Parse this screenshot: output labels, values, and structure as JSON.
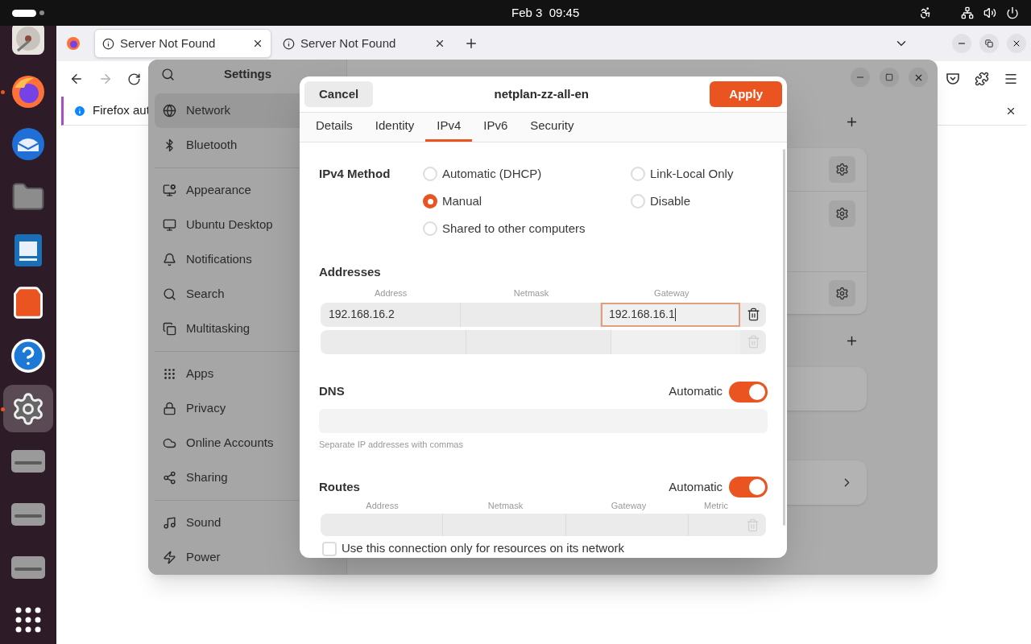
{
  "top_bar": {
    "clock": "Feb 3  09:45"
  },
  "dock": {
    "items": [
      {
        "kind": "disk",
        "selected": false,
        "running": false
      },
      {
        "kind": "browser",
        "selected": false,
        "running": true
      },
      {
        "kind": "mail",
        "selected": false,
        "running": false
      },
      {
        "kind": "files",
        "selected": false,
        "running": false
      },
      {
        "kind": "writer",
        "selected": false,
        "running": false
      },
      {
        "kind": "store",
        "selected": false,
        "running": false
      },
      {
        "kind": "help",
        "selected": false,
        "running": false
      },
      {
        "kind": "settings",
        "selected": true,
        "running": true
      },
      {
        "kind": "drive",
        "selected": false,
        "running": false
      },
      {
        "kind": "drive",
        "selected": false,
        "running": false
      },
      {
        "kind": "drive",
        "selected": false,
        "running": false
      },
      {
        "kind": "grid",
        "selected": false,
        "running": false
      }
    ]
  },
  "browser": {
    "tabs": [
      {
        "title": "Server Not Found",
        "selected": true
      },
      {
        "title": "Server Not Found",
        "selected": false
      }
    ],
    "forward_disabled": true,
    "notification": "Firefox aut"
  },
  "settings": {
    "title": "Settings",
    "sidebar": [
      [
        {
          "kind": "network",
          "label": "Network",
          "selected": true
        },
        {
          "kind": "bluetooth",
          "label": "Bluetooth",
          "selected": false
        }
      ],
      [
        {
          "kind": "appearance",
          "label": "Appearance",
          "selected": false
        },
        {
          "kind": "desktop",
          "label": "Ubuntu Desktop",
          "selected": false
        },
        {
          "kind": "bell",
          "label": "Notifications",
          "selected": false
        },
        {
          "kind": "search",
          "label": "Search",
          "selected": false
        },
        {
          "kind": "windows",
          "label": "Multitasking",
          "selected": false
        }
      ],
      [
        {
          "kind": "apps",
          "label": "Apps",
          "selected": false
        },
        {
          "kind": "lock",
          "label": "Privacy",
          "selected": false
        },
        {
          "kind": "cloud",
          "label": "Online Accounts",
          "selected": false
        },
        {
          "kind": "share",
          "label": "Sharing",
          "selected": false
        }
      ],
      [
        {
          "kind": "music",
          "label": "Sound",
          "selected": false
        },
        {
          "kind": "power",
          "label": "Power",
          "selected": false
        }
      ]
    ]
  },
  "dialog": {
    "title": "netplan-zz-all-en",
    "cancel": "Cancel",
    "apply": "Apply",
    "tabs": [
      {
        "label": "Details",
        "selected": false
      },
      {
        "label": "Identity",
        "selected": false
      },
      {
        "label": "IPv4",
        "selected": true
      },
      {
        "label": "IPv6",
        "selected": false
      },
      {
        "label": "Security",
        "selected": false
      }
    ],
    "method": {
      "label": "IPv4 Method",
      "options": [
        {
          "label": "Automatic (DHCP)",
          "selected": false
        },
        {
          "label": "Link-Local Only",
          "selected": false
        },
        {
          "label": "Manual",
          "selected": true
        },
        {
          "label": "Disable",
          "selected": false
        },
        {
          "label": "Shared to other computers",
          "selected": false
        }
      ]
    },
    "addresses": {
      "title": "Addresses",
      "columns": [
        "Address",
        "Netmask",
        "Gateway"
      ],
      "rows": [
        {
          "address": "192.168.16.2",
          "gateway": "192.168.16.1",
          "disabled": false
        },
        {
          "disabled": true
        }
      ]
    },
    "dns": {
      "title": "DNS",
      "switch_label": "Automatic",
      "on": true,
      "hint": "Separate IP addresses with commas"
    },
    "routes": {
      "title": "Routes",
      "switch_label": "Automatic",
      "on": true,
      "columns": [
        "Address",
        "Netmask",
        "Gateway",
        "Metric"
      ],
      "rows": [
        {
          "disabled": true
        }
      ]
    },
    "only_local": {
      "label": "Use this connection only for resources on its network",
      "checked": false
    }
  }
}
